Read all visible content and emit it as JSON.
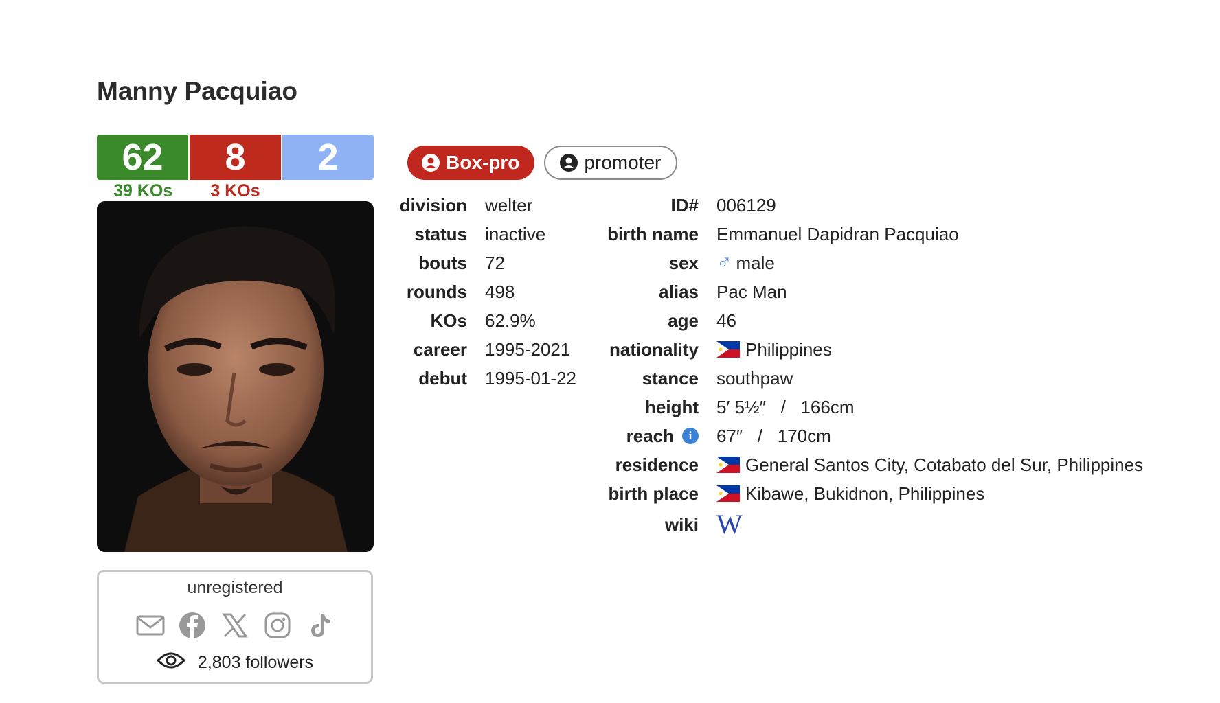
{
  "boxer": {
    "name": "Manny Pacquiao"
  },
  "record": {
    "wins": "62",
    "losses": "8",
    "draws": "2",
    "wins_kos": "39 KOs",
    "losses_kos": "3 KOs",
    "colors": {
      "wins": "#3a8a2c",
      "losses": "#bf2a1f",
      "draws": "#8fb2f5"
    }
  },
  "social": {
    "status": "unregistered",
    "icons": [
      "mail-icon",
      "facebook-icon",
      "x-icon",
      "instagram-icon",
      "tiktok-icon"
    ],
    "followers": "2,803 followers"
  },
  "tags": {
    "primary": "Box-pro",
    "secondary": "promoter"
  },
  "career_facts": [
    {
      "label": "division",
      "value": "welter"
    },
    {
      "label": "status",
      "value": "inactive"
    },
    {
      "label": "bouts",
      "value": "72"
    },
    {
      "label": "rounds",
      "value": "498"
    },
    {
      "label": "KOs",
      "value": "62.9%"
    },
    {
      "label": "career",
      "value": "1995-2021"
    },
    {
      "label": "debut",
      "value": "1995-01-22"
    }
  ],
  "personal_facts": {
    "id": {
      "label": "ID#",
      "value": "006129"
    },
    "birth_name": {
      "label": "birth name",
      "value": "Emmanuel Dapidran Pacquiao"
    },
    "sex": {
      "label": "sex",
      "symbol": "♂",
      "value": "male"
    },
    "alias": {
      "label": "alias",
      "value": "Pac Man"
    },
    "age": {
      "label": "age",
      "value": "46"
    },
    "nationality": {
      "label": "nationality",
      "value": "Philippines"
    },
    "stance": {
      "label": "stance",
      "value": "southpaw"
    },
    "height": {
      "label": "height",
      "value": "5′ 5½″   /   166cm"
    },
    "reach": {
      "label": "reach",
      "value": "67″   /   170cm"
    },
    "residence": {
      "label": "residence",
      "value": "General Santos City, Cotabato del Sur, Philippines"
    },
    "birth_place": {
      "label": "birth place",
      "value": "Kibawe, Bukidnon, Philippines"
    },
    "wiki": {
      "label": "wiki",
      "value": "W"
    }
  },
  "accent_colors": {
    "box_tag": "#c0271e",
    "info": "#3b82d6",
    "wiki": "#2746a7",
    "male": "#5b8ee0"
  }
}
